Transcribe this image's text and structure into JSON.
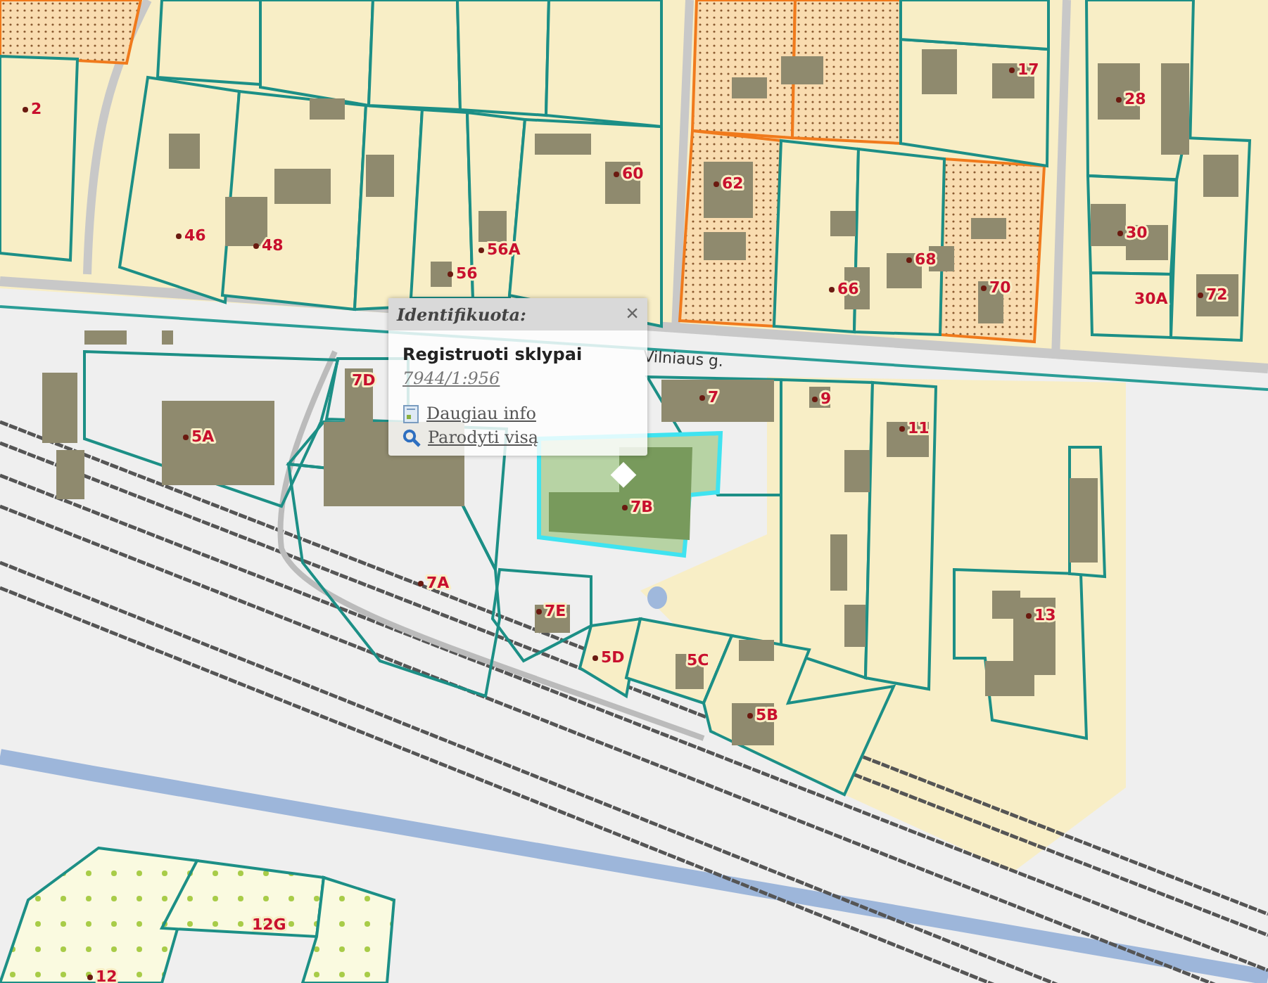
{
  "map": {
    "street_label": "Vilniaus g.",
    "parcel_labels": [
      {
        "text": "2"
      },
      {
        "text": "46"
      },
      {
        "text": "48"
      },
      {
        "text": "56"
      },
      {
        "text": "56A"
      },
      {
        "text": "60"
      },
      {
        "text": "62"
      },
      {
        "text": "66"
      },
      {
        "text": "68"
      },
      {
        "text": "17"
      },
      {
        "text": "70"
      },
      {
        "text": "28"
      },
      {
        "text": "30"
      },
      {
        "text": "30A"
      },
      {
        "text": "72"
      },
      {
        "text": "7D"
      },
      {
        "text": "5A"
      },
      {
        "text": "7"
      },
      {
        "text": "9"
      },
      {
        "text": "11"
      },
      {
        "text": "7B"
      },
      {
        "text": "7A"
      },
      {
        "text": "7E"
      },
      {
        "text": "13"
      },
      {
        "text": "5D"
      },
      {
        "text": "5C"
      },
      {
        "text": "5B"
      },
      {
        "text": "12G"
      },
      {
        "text": "12"
      }
    ]
  },
  "popup": {
    "title": "Identifikuota:",
    "close": "×",
    "layer": "Registruoti sklypai",
    "parcel_id": "7944/1:956",
    "links": [
      {
        "kind": "info",
        "label": "Daugiau info"
      },
      {
        "kind": "zoom",
        "label": "Parodyti visą"
      }
    ]
  }
}
